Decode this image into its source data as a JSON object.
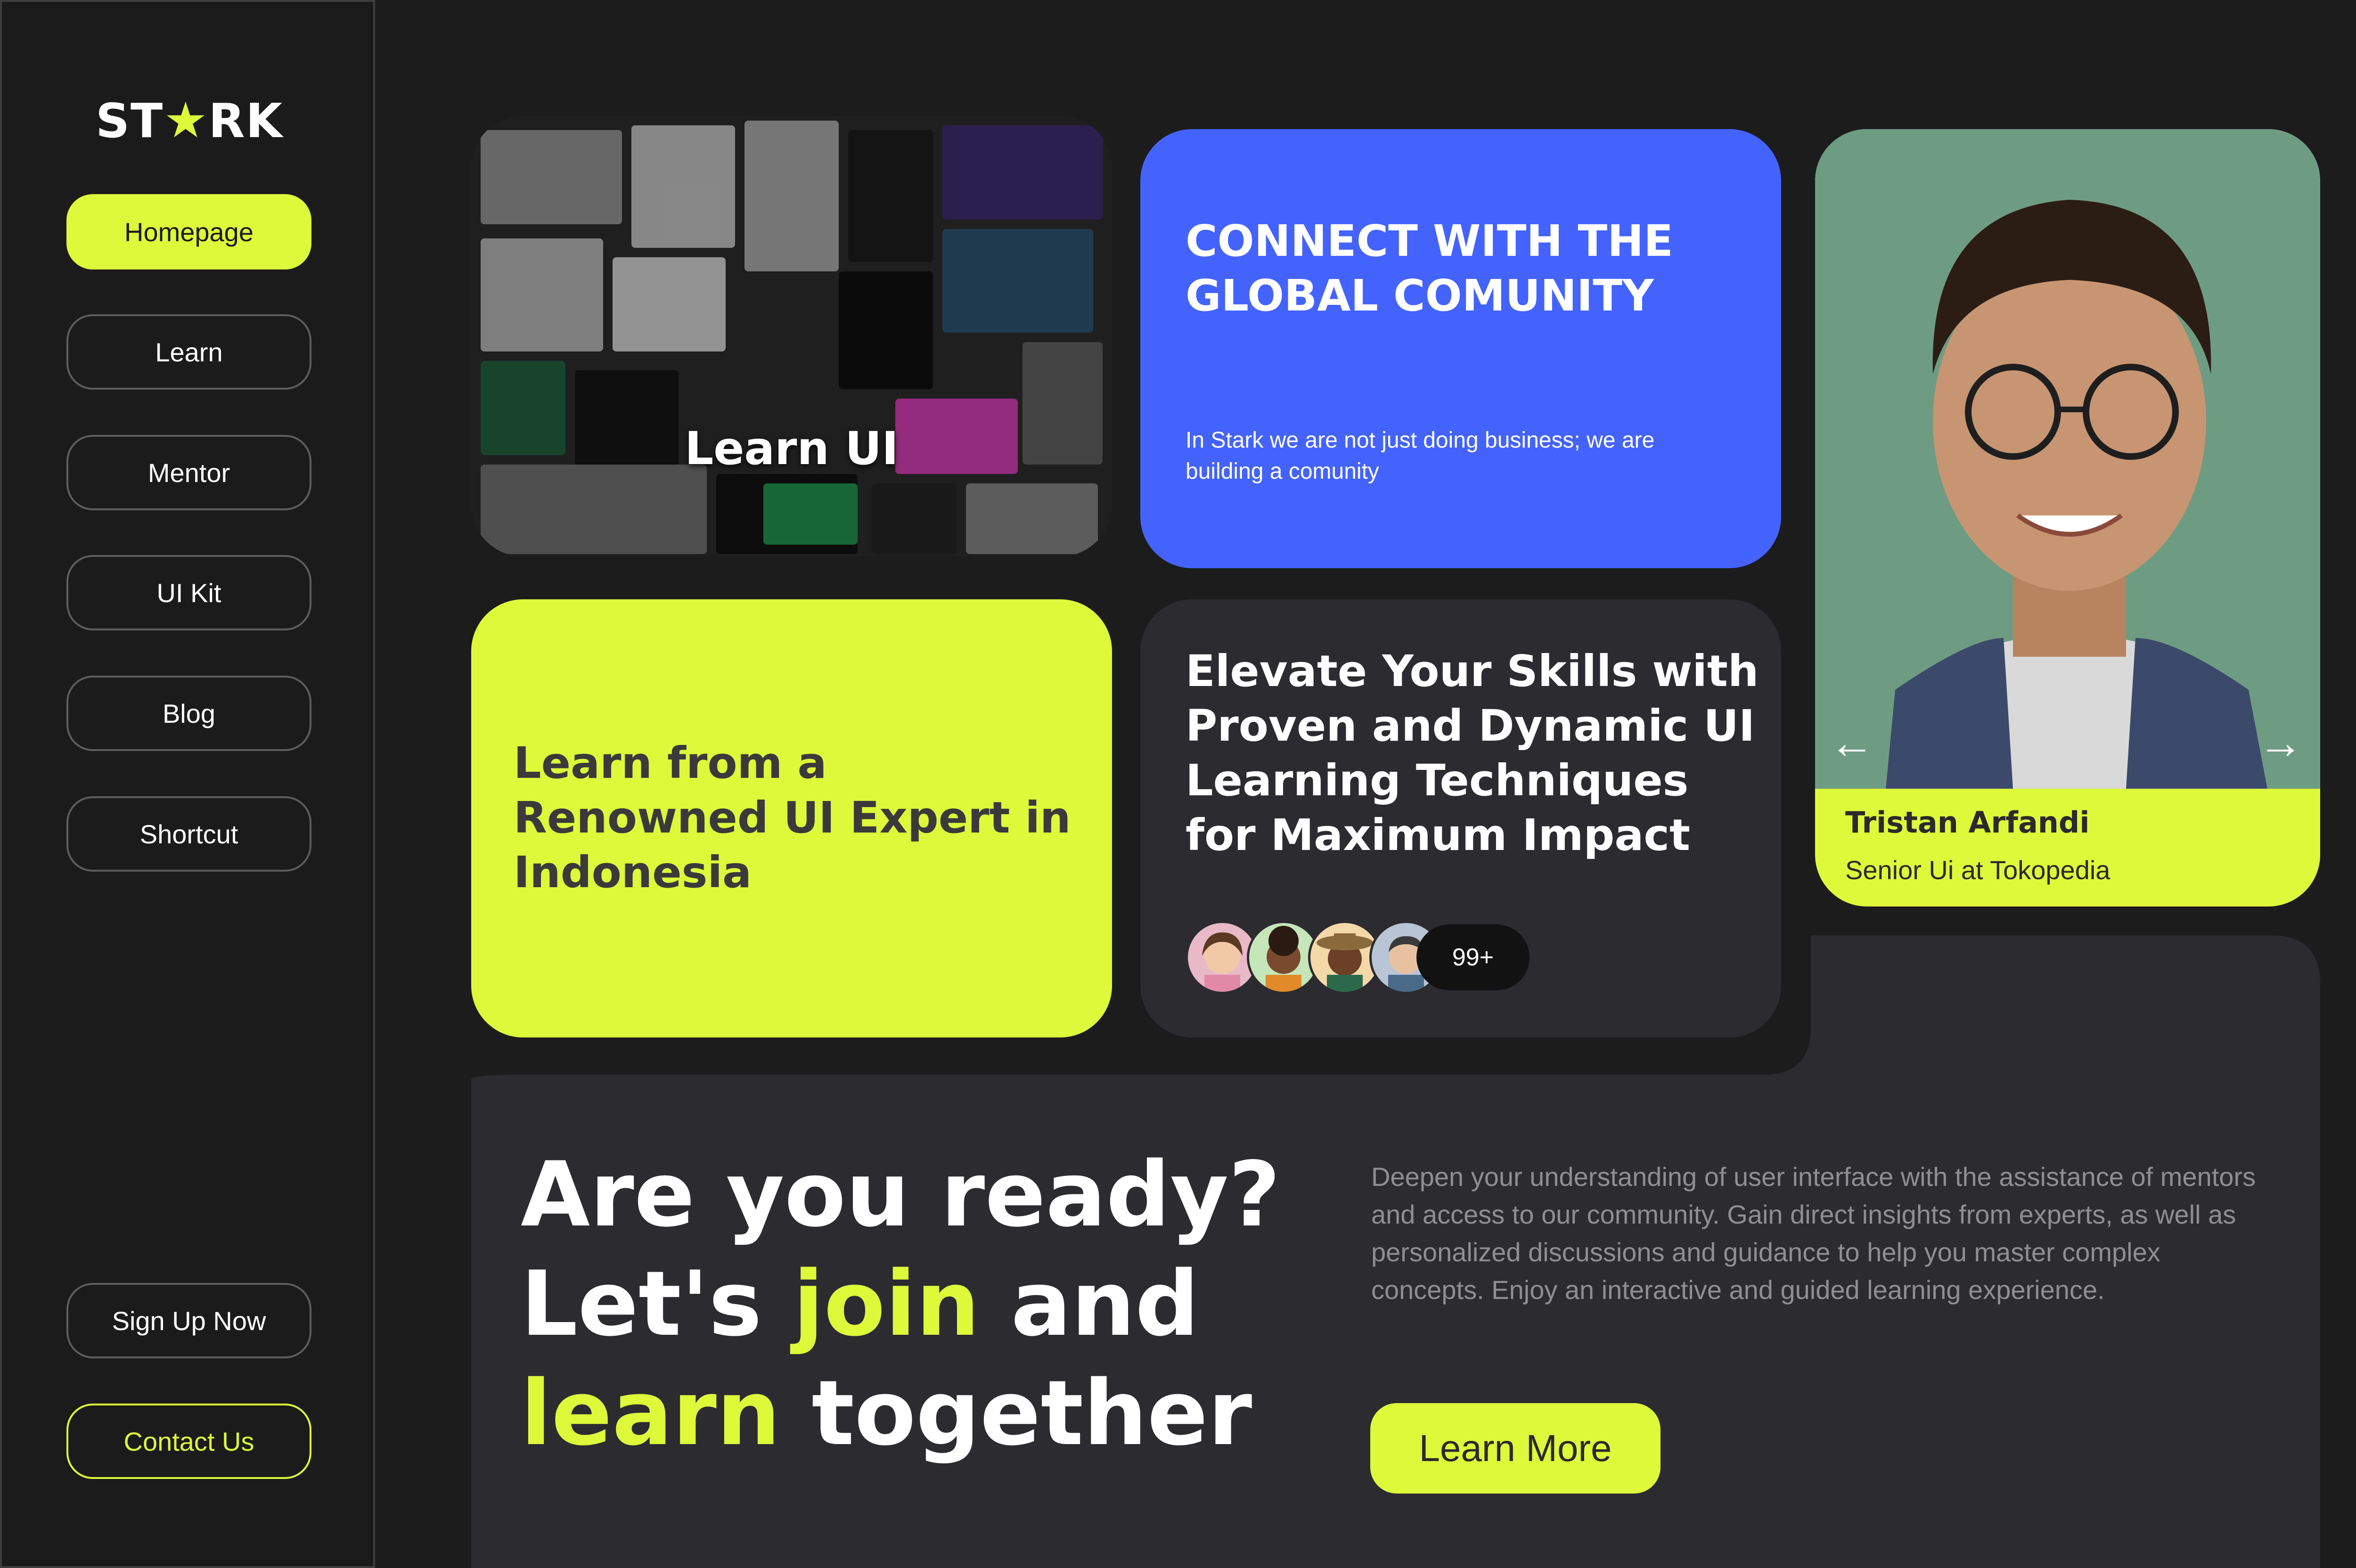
{
  "brand": {
    "logo_left": "ST",
    "logo_star": "★",
    "logo_right": "RK"
  },
  "sidebar": {
    "items": [
      {
        "label": "Homepage",
        "active": true
      },
      {
        "label": "Learn"
      },
      {
        "label": "Mentor"
      },
      {
        "label": "UI Kit"
      },
      {
        "label": "Blog"
      },
      {
        "label": "Shortcut"
      }
    ],
    "signup_label": "Sign Up Now",
    "contact_label": "Contact Us"
  },
  "cards": {
    "learn_ui": {
      "title": "Learn UI"
    },
    "connect": {
      "title": "CONNECT WITH THE GLOBAL COMUNITY",
      "subtitle": "In Stark we are not just doing business; we are building a comunity"
    },
    "profile": {
      "name": "Tristan Arfandi",
      "role": "Senior Ui at Tokopedia",
      "prev_icon": "arrow-left-icon",
      "next_icon": "arrow-right-icon"
    },
    "expert": {
      "title": "Learn from a Renowned UI Expert in Indonesia"
    },
    "elevate": {
      "title": "Elevate Your Skills with Proven and Dynamic UI Learning Techniques for Maximum Impact",
      "member_count": "99+"
    }
  },
  "cta": {
    "line1": "Are you ready?",
    "line2_a": "Let's ",
    "line2_hl": "join",
    "line2_b": " and",
    "line3_hl": "learn",
    "line3_b": " together",
    "description": "Deepen your understanding of user interface with the assistance of mentors and access to our community. Gain direct insights from experts, as well as personalized discussions and guidance to help you master complex concepts. Enjoy an interactive and guided learning experience.",
    "button_label": "Learn More"
  },
  "colors": {
    "accent": "#dcf93a",
    "blue": "#4463fd",
    "panel": "#2b2b30",
    "background": "#1c1c1c"
  }
}
